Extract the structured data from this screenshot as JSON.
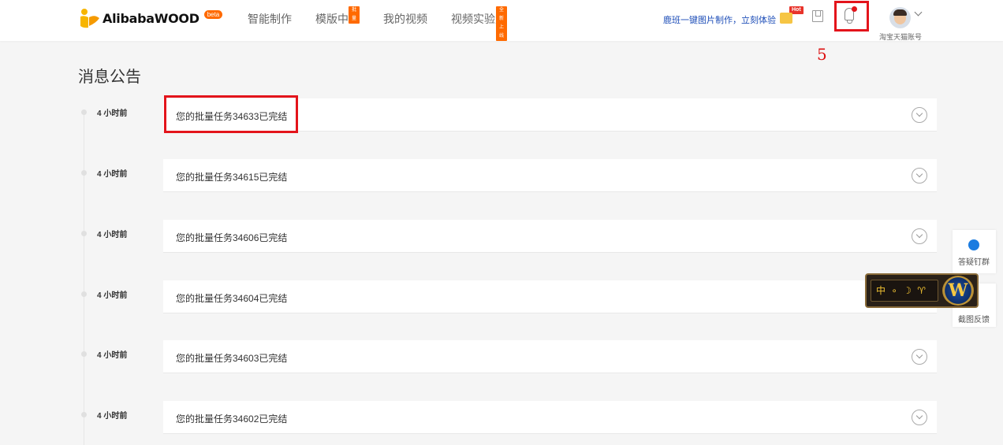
{
  "header": {
    "logo_text": "AlibabaWOOD",
    "logo_badge": "beta",
    "nav": [
      {
        "label": "智能制作",
        "badge": ""
      },
      {
        "label": "模版中心",
        "badge": "批量"
      },
      {
        "label": "我的视频",
        "badge": ""
      },
      {
        "label": "视频实验室",
        "badge": "全新上线"
      }
    ],
    "promo_link": "鹿班一键图片制作，立刻体验",
    "hot_tag": "Hot",
    "account_label": "淘宝天猫账号",
    "annotation_number": "5"
  },
  "page": {
    "title": "消息公告"
  },
  "notices": [
    {
      "time": "4 小时前",
      "text": "您的批量任务34633已完结"
    },
    {
      "time": "4 小时前",
      "text": "您的批量任务34615已完结"
    },
    {
      "time": "4 小时前",
      "text": "您的批量任务34606已完结"
    },
    {
      "time": "4 小时前",
      "text": "您的批量任务34604已完结"
    },
    {
      "time": "4 小时前",
      "text": "您的批量任务34603已完结"
    },
    {
      "time": "4 小时前",
      "text": "您的批量任务34602已完结"
    }
  ],
  "side": {
    "qa_group": "答疑钉群",
    "feedback": "截图反馈",
    "game_bar_text": "中 ∘ ☽ ♈"
  },
  "colors": {
    "accent_orange": "#ff6a00",
    "annotation_red": "#e3141b",
    "link_blue": "#1e4eb8"
  }
}
